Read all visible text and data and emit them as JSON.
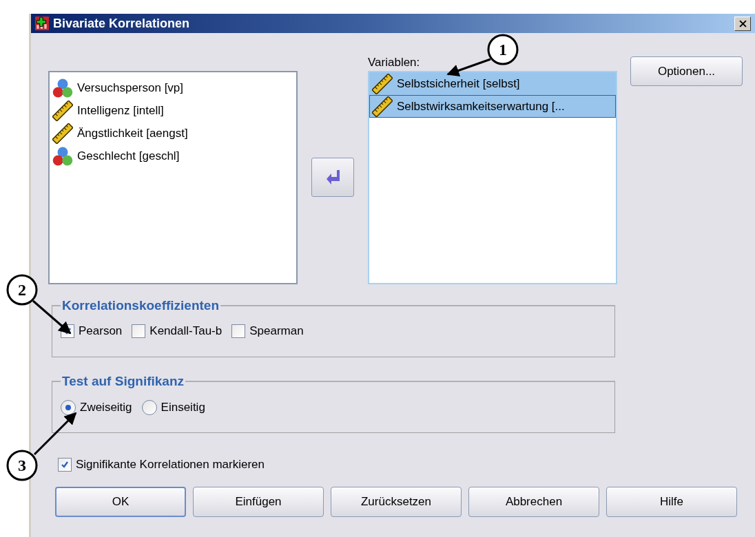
{
  "window": {
    "title": "Bivariate Korrelationen"
  },
  "source_list": {
    "items": [
      {
        "label": "Versuchsperson [vp]",
        "kind": "nominal"
      },
      {
        "label": "Intelligenz [intell]",
        "kind": "scale"
      },
      {
        "label": "Ängstlichkeit [aengst]",
        "kind": "scale"
      },
      {
        "label": "Geschlecht [geschl]",
        "kind": "nominal"
      }
    ]
  },
  "target_list": {
    "label": "Variablen:",
    "items": [
      {
        "label": "Selbstsicherheit [selbst]",
        "kind": "scale",
        "selected": true,
        "focused": false
      },
      {
        "label": "Selbstwirksamkeitserwartung [...",
        "kind": "scale",
        "selected": true,
        "focused": true
      }
    ]
  },
  "options_button": "Optionen...",
  "coefficients": {
    "legend": "Korrelationskoeffizienten",
    "options": [
      {
        "label": "Pearson",
        "checked": true
      },
      {
        "label": "Kendall-Tau-b",
        "checked": false
      },
      {
        "label": "Spearman",
        "checked": false
      }
    ]
  },
  "significance": {
    "legend": "Test auf Signifikanz",
    "options": [
      {
        "label": "Zweiseitig",
        "selected": true
      },
      {
        "label": "Einseitig",
        "selected": false
      }
    ]
  },
  "flag": {
    "label": "Signifikante Korrelationen markieren",
    "checked": true
  },
  "buttons": [
    {
      "label": "OK",
      "default": true
    },
    {
      "label": "Einfügen",
      "default": false
    },
    {
      "label": "Zurücksetzen",
      "default": false
    },
    {
      "label": "Abbrechen",
      "default": false
    },
    {
      "label": "Hilfe",
      "default": false
    }
  ],
  "annotations": [
    "1",
    "2",
    "3"
  ]
}
